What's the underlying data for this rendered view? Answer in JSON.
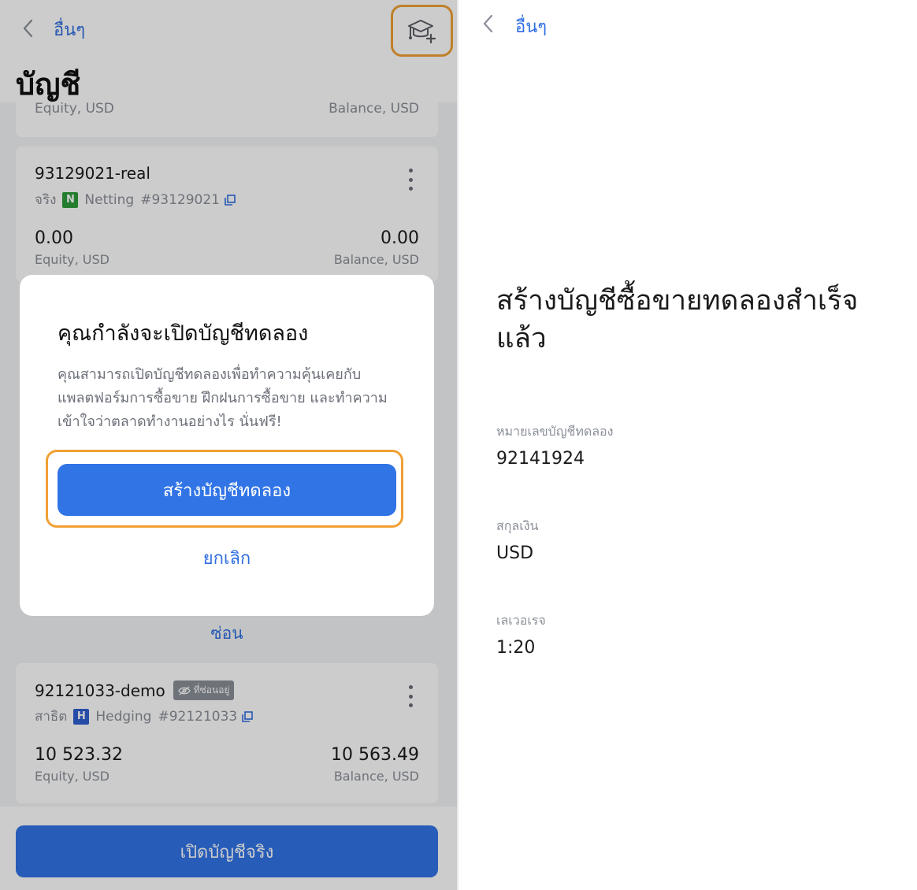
{
  "left": {
    "back_label": "อื่นๆ",
    "page_title": "บัญชี",
    "partial_card": {
      "equity_label": "Equity, USD",
      "balance_label": "Balance, USD"
    },
    "real_account": {
      "name": "93129021-real",
      "type": "จริง",
      "mode_badge": "N",
      "mode": "Netting",
      "number": "#93129021",
      "equity": "0.00",
      "balance": "0.00",
      "equity_label": "Equity, USD",
      "balance_label": "Balance, USD"
    },
    "hide_link": "ซ่อน",
    "demo_account": {
      "name": "92121033-demo",
      "hidden_badge": "ที่ซ่อนอยู่",
      "type": "สาธิต",
      "mode_badge": "H",
      "mode": "Hedging",
      "number": "#92121033",
      "equity": "10 523.32",
      "balance": "10 563.49",
      "equity_label": "Equity, USD",
      "balance_label": "Balance, USD"
    },
    "open_real_button": "เปิดบัญชีจริง",
    "dialog": {
      "title": "คุณกำลังจะเปิดบัญชีทดลอง",
      "body": "คุณสามารถเปิดบัญชีทดลองเพื่อทำความคุ้นเคยกับแพลตฟอร์มการซื้อขาย ฝึกฝนการซื้อขาย และทำความเข้าใจว่าตลาดทำงานอย่างไร นั่นฟรี!",
      "primary_button": "สร้างบัญชีทดลอง",
      "cancel_button": "ยกเลิก"
    }
  },
  "right": {
    "back_label": "อื่นๆ",
    "title": "สร้างบัญชีซื้อขายทดลองสำเร็จแล้ว",
    "fields": [
      {
        "label": "หมายเลขบัญชีทดลอง",
        "value": "92141924"
      },
      {
        "label": "สกุลเงิน",
        "value": "USD"
      },
      {
        "label": "เลเวอเรจ",
        "value": "1:20"
      }
    ]
  },
  "colors": {
    "accent": "#3174e6",
    "link": "#2f6ee0",
    "highlight": "#f0a035",
    "netting_badge": "#2d9d3a",
    "hedging_badge": "#2f5fd0"
  }
}
